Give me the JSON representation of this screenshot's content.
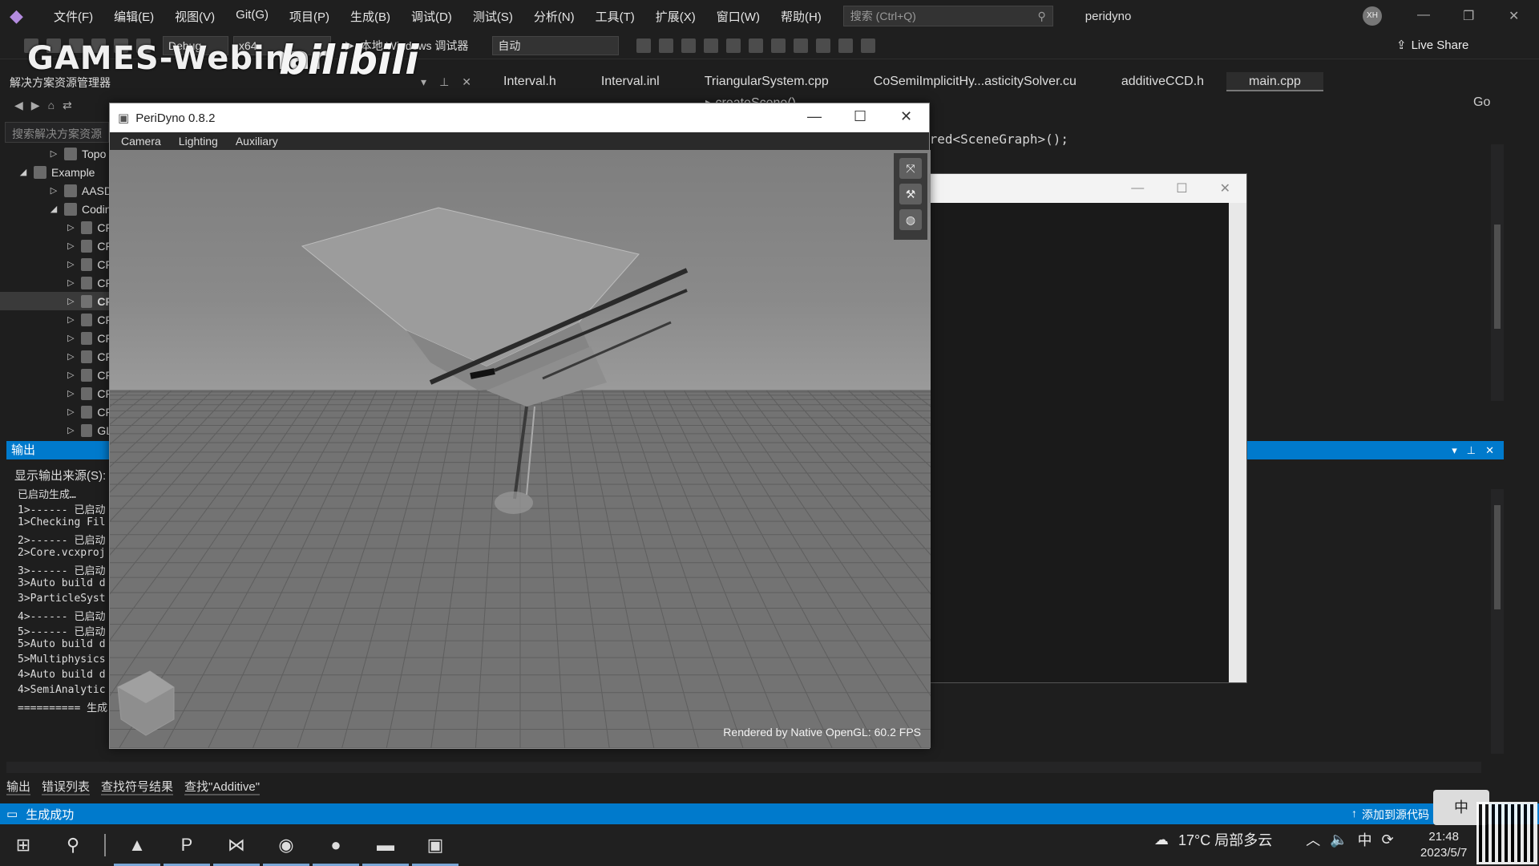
{
  "vs": {
    "menu": [
      "文件(F)",
      "编辑(E)",
      "视图(V)",
      "Git(G)",
      "项目(P)",
      "生成(B)",
      "调试(D)",
      "测试(S)",
      "分析(N)",
      "工具(T)",
      "扩展(X)",
      "窗口(W)",
      "帮助(H)"
    ],
    "search_placeholder": "搜索 (Ctrl+Q)",
    "solution_name": "peridyno",
    "avatar": "XH",
    "toolbar": {
      "config": "Debug",
      "platform": "x64",
      "debugger": "本地 Windows 调试器",
      "auto": "自动",
      "live_share": "Live Share"
    },
    "watermark": "GAMES-Webinar",
    "bili": "bilibili"
  },
  "solution_explorer": {
    "title": "解决方案资源管理器",
    "search_placeholder": "搜索解决方案资源",
    "items": [
      {
        "label": "Topo",
        "indent": 1
      },
      {
        "label": "Example",
        "indent": 0
      },
      {
        "label": "AASD",
        "indent": 1
      },
      {
        "label": "Codin",
        "indent": 1
      },
      {
        "label": "CF",
        "indent": 2
      },
      {
        "label": "CF",
        "indent": 2
      },
      {
        "label": "CF",
        "indent": 2
      },
      {
        "label": "CF",
        "indent": 2
      },
      {
        "label": "CF",
        "indent": 2,
        "selected": true
      },
      {
        "label": "CF",
        "indent": 2
      },
      {
        "label": "CF",
        "indent": 2
      },
      {
        "label": "CF",
        "indent": 2
      },
      {
        "label": "CF",
        "indent": 2
      },
      {
        "label": "CF",
        "indent": 2
      },
      {
        "label": "CF",
        "indent": 2
      },
      {
        "label": "GL",
        "indent": 2
      }
    ]
  },
  "editor": {
    "tabs": [
      "Interval.h",
      "Interval.inl",
      "TriangularSystem.cpp",
      "CoSemiImplicitHy...asticitySolver.cu",
      "additiveCCD.h",
      "main.cpp"
    ],
    "active_tab": "main.cpp",
    "nav_scope": "createScene()",
    "code_fragment": "ared<SceneGraph>();",
    "go_label": "Go"
  },
  "output": {
    "title": "输出",
    "source_label": "显示输出来源(S):",
    "lines": [
      "已启动生成…",
      "1>------ 已启动",
      "1>Checking Fil",
      "2>------ 已启动",
      "2>Core.vcxproj",
      "3>------ 已启动",
      "3>Auto build d",
      "3>ParticleSyst",
      "4>------ 已启动",
      "5>------ 已启动",
      "5>Auto build d",
      "5>Multiphysics",
      "4>Auto build d",
      "4>SemiAnalytic",
      "========== 生成"
    ]
  },
  "bottom_tabs": [
    "输出",
    "错误列表",
    "查找符号结果",
    "查找\"Additive\""
  ],
  "status": {
    "text": "生成成功",
    "right": "添加到源代码"
  },
  "peridyno": {
    "title": "PeriDyno 0.8.2",
    "menus": [
      "Camera",
      "Lighting",
      "Auxiliary"
    ],
    "fps_text": "Rendered by Native OpenGL: 60.2 FPS"
  },
  "tray": {
    "weather": "17°C 局部多云",
    "time": "21:48",
    "date": "2023/5/7",
    "ime": "中"
  }
}
